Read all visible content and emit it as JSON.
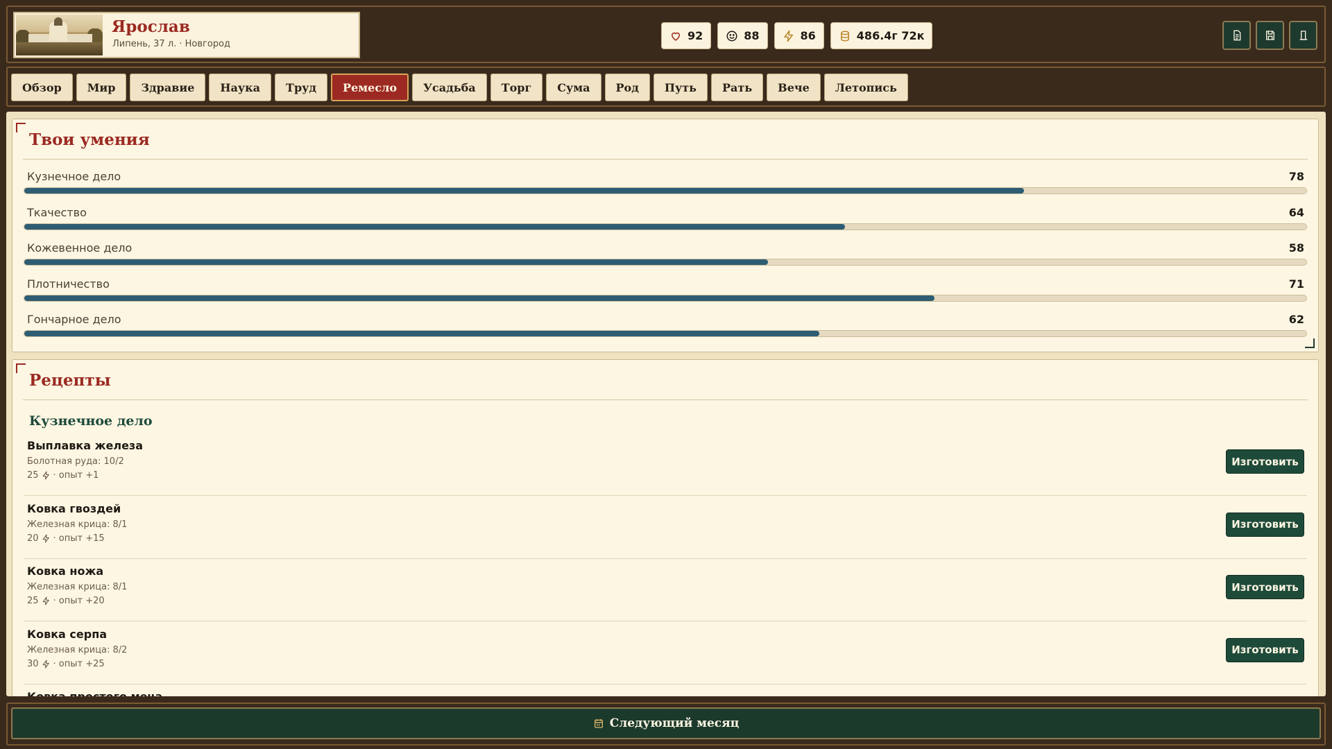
{
  "profile": {
    "name": "Ярослав",
    "subtitle": "Липень, 37 л. · Новгород"
  },
  "stats": {
    "health": "92",
    "mood": "88",
    "energy": "86",
    "money": "486.4г 72к"
  },
  "tabs": [
    {
      "label": "Обзор",
      "active": false
    },
    {
      "label": "Мир",
      "active": false
    },
    {
      "label": "Здравие",
      "active": false
    },
    {
      "label": "Наука",
      "active": false
    },
    {
      "label": "Труд",
      "active": false
    },
    {
      "label": "Ремесло",
      "active": true
    },
    {
      "label": "Усадьба",
      "active": false
    },
    {
      "label": "Торг",
      "active": false
    },
    {
      "label": "Сума",
      "active": false
    },
    {
      "label": "Род",
      "active": false
    },
    {
      "label": "Путь",
      "active": false
    },
    {
      "label": "Рать",
      "active": false
    },
    {
      "label": "Вече",
      "active": false
    },
    {
      "label": "Летопись",
      "active": false
    }
  ],
  "skills_panel": {
    "title": "Твои умения",
    "skills": [
      {
        "name": "Кузнечное дело",
        "value": "78",
        "progress": 0.78
      },
      {
        "name": "Ткачество",
        "value": "64",
        "progress": 0.64
      },
      {
        "name": "Кожевенное дело",
        "value": "58",
        "progress": 0.58
      },
      {
        "name": "Плотничество",
        "value": "71",
        "progress": 0.71
      },
      {
        "name": "Гончарное дело",
        "value": "62",
        "progress": 0.62
      }
    ]
  },
  "recipes_panel": {
    "title": "Рецепты",
    "category": "Кузнечное дело",
    "craft_label": "Изготовить",
    "recipes": [
      {
        "name": "Выплавка железа",
        "materials": "Болотная руда: 10/2",
        "energy": "25",
        "xp": "· опыт +1"
      },
      {
        "name": "Ковка гвоздей",
        "materials": "Железная крица: 8/1",
        "energy": "20",
        "xp": "· опыт +15"
      },
      {
        "name": "Ковка ножа",
        "materials": "Железная крица: 8/1",
        "energy": "25",
        "xp": "· опыт +20"
      },
      {
        "name": "Ковка серпа",
        "materials": "Железная крица: 8/2",
        "energy": "30",
        "xp": "· опыт +25"
      },
      {
        "name": "Ковка простого меча",
        "materials": "",
        "energy": "",
        "xp": ""
      }
    ]
  },
  "footer": {
    "next_month": "Следующий месяц"
  },
  "colors": {
    "accent_red": "#9c2a22",
    "accent_green": "#1e4a3a",
    "skill_bar": "#2e5d73",
    "frame": "#3a2a1c"
  }
}
